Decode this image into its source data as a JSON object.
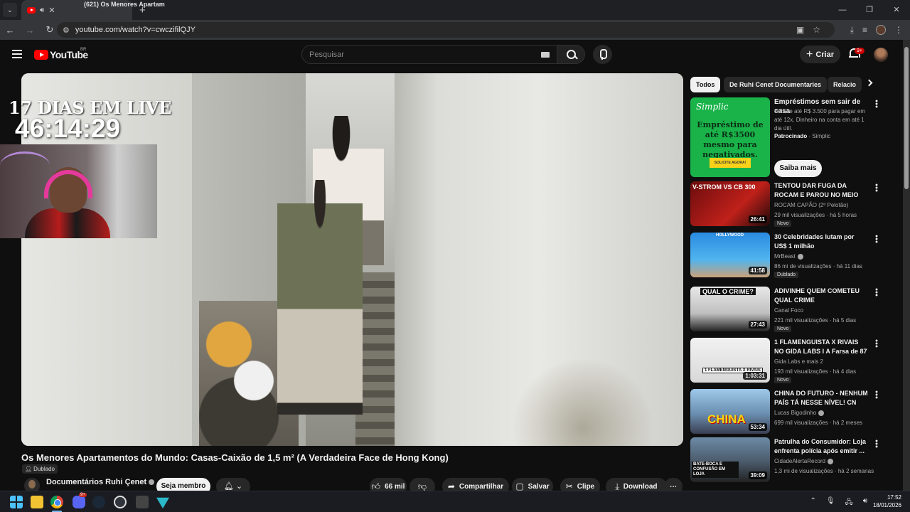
{
  "browser": {
    "tab_title": "(621) Os Menores Apartam",
    "url": "youtube.com/watch?v=cwczifilQJY"
  },
  "youtube": {
    "region": "BR",
    "logo_text": "YouTube",
    "search_placeholder": "Pesquisar",
    "create_label": "Criar",
    "notif_badge": "9+"
  },
  "video": {
    "overlay_title": "17 DIAS EM LIVE",
    "overlay_timer": "46:14:29",
    "title": "Os Menores Apartamentos do Mundo: Casas-Caixão de 1,5 m² (A Verdadeira Face de Hong Kong)",
    "dubbed": "Dublado",
    "channel": "Documentários Ruhi Çenet",
    "member_btn": "Seja membro",
    "likes": "66 mil",
    "share": "Compartilhar",
    "save": "Salvar",
    "clip": "Clipe",
    "download": "Download"
  },
  "sidebar": {
    "chips": [
      "Todos",
      "De Ruhi Cenet Documentaries",
      "Relacio"
    ],
    "ad": {
      "logo": "Simplic",
      "image_text": "Empréstimo de até R$3500 mesmo para negativados.",
      "image_btn": "SOLICITE AGORA!",
      "title": "Empréstimos sem sair de casa",
      "desc": "Solicite até R$ 3.500 para pagar em até 12x. Dinheiro na conta em até 1 dia útil.",
      "sponsored": "Patrocinado",
      "advertiser": "· Simplic",
      "cta": "Saiba mais"
    },
    "videos": [
      {
        "title": "TENTOU DAR FUGA DA ROCAM E PAROU NO MEIO DO LIXO",
        "channel": "ROCAM CAPÃO (2º Pelotão)",
        "meta": "29 mil visualizações · há 5 horas",
        "duration": "26:41",
        "tag": "Novo"
      },
      {
        "title": "30 Celebridades lutam por US$ 1 milhão",
        "channel": "MrBeast",
        "meta": "86 mi de visualizações · há 11 dias",
        "duration": "41:58",
        "tag": "Dublado"
      },
      {
        "title": "ADIVINHE QUEM COMETEU QUAL CRIME",
        "channel": "Canal Foco",
        "meta": "221 mil visualizações · há 5 dias",
        "duration": "27:43",
        "tag": "Novo"
      },
      {
        "title": "1 FLAMENGUISTA X RIVAIS NO GIDA LABS I A Farsa de 87",
        "channel": "Gida Labs e mais 2",
        "meta": "193 mil visualizações · há 4 dias",
        "duration": "1:03:31",
        "tag": "Novo"
      },
      {
        "title": "CHINA DO FUTURO - NENHUM PAÍS TÁ NESSE NÍVEL! CN",
        "channel": "Lucas Bigodinho",
        "meta": "699 mil visualizações · há 2 meses",
        "duration": "53:34",
        "tag": ""
      },
      {
        "title": "Patrulha do Consumidor: Loja enfrenta polícia após emitir ...",
        "channel": "CidadeAlertaRecord",
        "meta": "1,3 mi de visualizações · há 2 semanas",
        "duration": "39:09",
        "tag": ""
      }
    ],
    "thumb_texts": [
      "V-STROM VS CB 300",
      "HOLLYWOOD",
      "QUAL O CRIME?",
      "1 FLAMENGUISTA X RIVAIS",
      "CHINA",
      "BATE-BOCA E CONFUSÃO EM LOJA"
    ]
  },
  "taskbar": {
    "discord_badge": "9+",
    "time": "17:52",
    "date": "18/01/2026"
  },
  "colors": {
    "yt_red": "#ff0000",
    "ad_green": "#1ab34a",
    "page_bg": "#0f0f0f"
  }
}
